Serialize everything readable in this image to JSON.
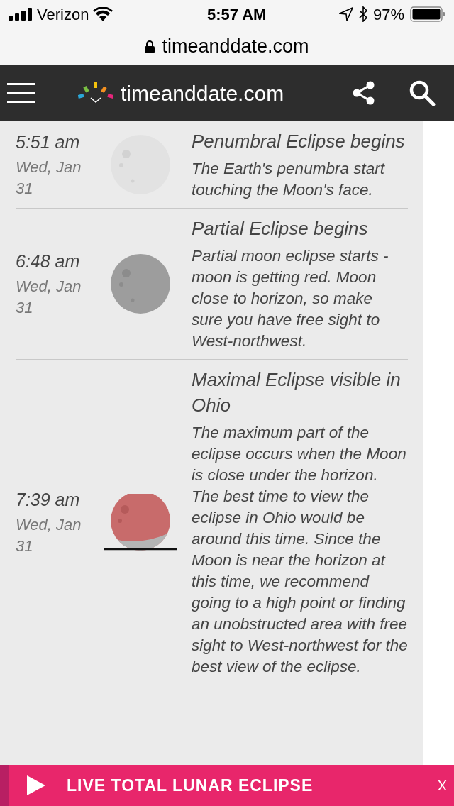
{
  "status_bar": {
    "carrier": "Verizon",
    "time": "5:57 AM",
    "battery": "97%"
  },
  "url_bar": {
    "domain": "timeanddate.com"
  },
  "header": {
    "logo_text": "timeanddate.com"
  },
  "events": [
    {
      "time": "5:51 am",
      "date": "Wed, Jan 31",
      "kind": "light",
      "title": "Penumbral Eclipse begins",
      "description": "The Earth's penumbra start touching the Moon's face."
    },
    {
      "time": "6:48 am",
      "date": "Wed, Jan 31",
      "kind": "dark",
      "title": "Partial Eclipse begins",
      "description": "Partial moon eclipse starts - moon is getting red. Moon close to horizon, so make sure you have free sight to West-northwest."
    },
    {
      "time": "7:39 am",
      "date": "Wed, Jan 31",
      "kind": "red_horizon",
      "title": "Maximal Eclipse visible in Ohio",
      "description": "The maximum part of the eclipse occurs when the Moon is close under the horizon. The best time to view the eclipse in Ohio would be around this time. Since the Moon is near the horizon at this time, we recommend going to a high point or finding an unobstructed area with free sight to West-northwest for the best view of the eclipse."
    }
  ],
  "banner": {
    "label": "LIVE TOTAL LUNAR ECLIPSE",
    "close": "X"
  }
}
